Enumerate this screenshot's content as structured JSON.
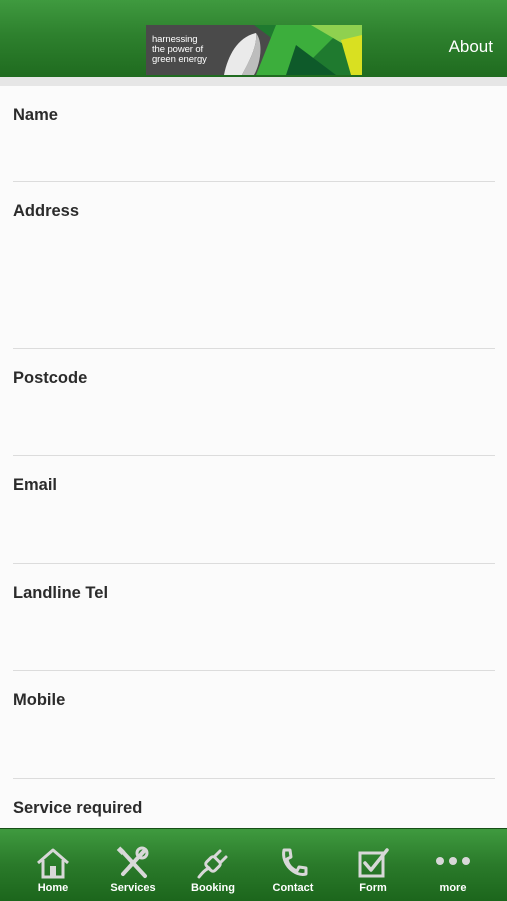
{
  "header": {
    "logo_text": "harnessing\nthe power of\ngreen energy",
    "about_label": "About"
  },
  "form": {
    "fields": [
      {
        "label": "Name"
      },
      {
        "label": "Address"
      },
      {
        "label": "Postcode"
      },
      {
        "label": "Email"
      },
      {
        "label": "Landline Tel"
      },
      {
        "label": "Mobile"
      },
      {
        "label": "Service required"
      }
    ]
  },
  "tabbar": {
    "tabs": [
      {
        "label": "Home",
        "icon": "home-icon"
      },
      {
        "label": "Services",
        "icon": "tools-icon"
      },
      {
        "label": "Booking",
        "icon": "plug-icon"
      },
      {
        "label": "Contact",
        "icon": "phone-icon"
      },
      {
        "label": "Form",
        "icon": "checkbox-icon"
      },
      {
        "label": "more",
        "icon": "more-icon"
      }
    ]
  },
  "colors": {
    "brand_green": "#2e812e",
    "tab_text": "#ffffff",
    "label_text": "#2b2b2b"
  }
}
